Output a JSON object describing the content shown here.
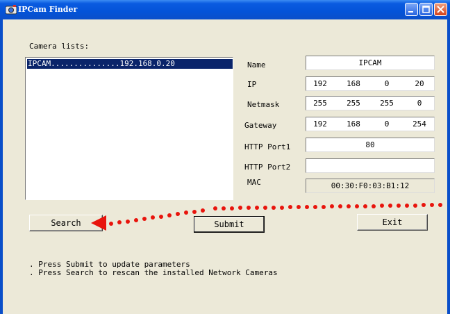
{
  "window": {
    "title": "IPCam Finder"
  },
  "camera_list": {
    "label": "Camera lists:",
    "items": [
      {
        "name": "IPCAM",
        "ip": "192.168.0.20",
        "display": "IPCAM...............192.168.0.20"
      }
    ]
  },
  "fields": {
    "name_label": "Name",
    "name_value": "IPCAM",
    "ip_label": "IP",
    "ip": [
      "192",
      "168",
      "0",
      "20"
    ],
    "netmask_label": "Netmask",
    "netmask": [
      "255",
      "255",
      "255",
      "0"
    ],
    "gateway_label": "Gateway",
    "gateway": [
      "192",
      "168",
      "0",
      "254"
    ],
    "http_port1_label": "HTTP Port1",
    "http_port1_value": "80",
    "http_port2_label": "HTTP Port2",
    "http_port2_value": "",
    "mac_label": "MAC",
    "mac_value": "00:30:F0:03:B1:12"
  },
  "buttons": {
    "search": "Search",
    "submit": "Submit",
    "exit": "Exit"
  },
  "instructions": [
    ". Press Submit to update parameters",
    ". Press Search to rescan the installed Network Cameras"
  ],
  "annotation": {
    "color": "#E8140C"
  },
  "colors": {
    "titlebar": "#0453D8",
    "selection": "#0A246A",
    "dialog_bg": "#ECE9D8"
  },
  "icons": {
    "app": "camera-icon",
    "minimize": "minimize-icon",
    "maximize": "maximize-icon",
    "close": "close-icon"
  }
}
